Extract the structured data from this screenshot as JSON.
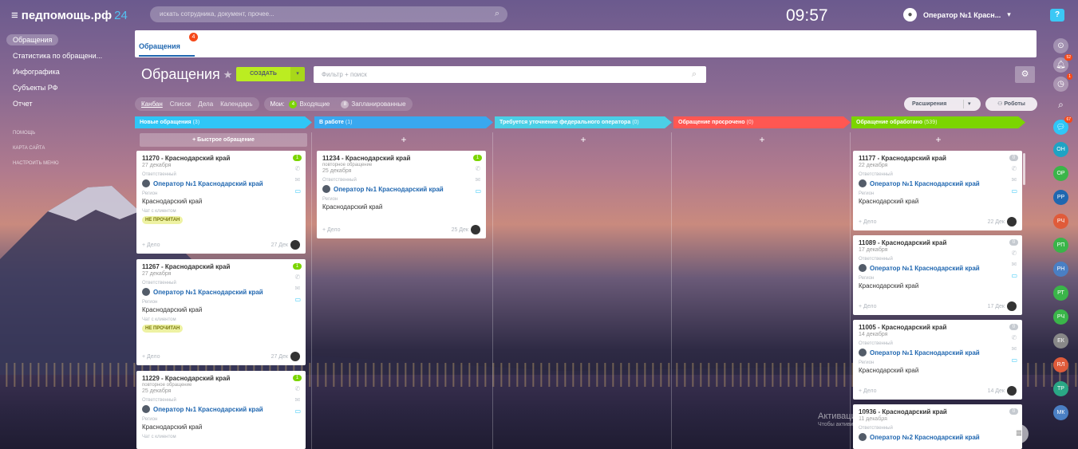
{
  "app": {
    "logo": "педпомощь.рф",
    "logo_num": "24",
    "search_placeholder": "искать сотрудника, документ, прочее...",
    "clock": "09:57",
    "user_name": "Оператор №1 Красн..."
  },
  "leftmenu": {
    "items": [
      "Обращения",
      "Статистика по обращени...",
      "Инфографика",
      "Субъекты РФ",
      "Отчет"
    ],
    "small": [
      "ПОМОЩЬ",
      "КАРТА САЙТА",
      "НАСТРОИТЬ МЕНЮ"
    ]
  },
  "tabs": {
    "active": "Обращения",
    "badge": "4"
  },
  "page": {
    "title": "Обращения",
    "create_label": "СОЗДАТЬ",
    "filter_placeholder": "Фильтр + поиск"
  },
  "viewbar": {
    "views": [
      "Канбан",
      "Список",
      "Дела",
      "Календарь"
    ],
    "mine": "Мои:",
    "incoming_count": "4",
    "incoming": "Входящие",
    "planned_count": "8",
    "planned": "Запланированные",
    "extensions": "Расширения",
    "robots": "Роботы"
  },
  "columns": [
    {
      "name": "Новые обращения",
      "count": "(3)",
      "color": "#2fc6f6"
    },
    {
      "name": "В работе",
      "count": "(1)",
      "color": "#39a8ef"
    },
    {
      "name": "Требуется уточнение федерального оператора",
      "count": "(0)",
      "color": "#4bcfe6"
    },
    {
      "name": "Обращение просрочено",
      "count": "(0)",
      "color": "#ff5752"
    },
    {
      "name": "Обращение обработано",
      "count": "(539)",
      "color": "#7bd500"
    }
  ],
  "quick_add": "+ Быстрое обращение",
  "labels": {
    "responsible": "Ответственный",
    "region": "Регион",
    "chat": "Чат с клиентом",
    "unread": "НЕ ПРОЧИТАН",
    "add_deal": "+ Дело",
    "repeat": "повторное обращение"
  },
  "cards": {
    "c11270": {
      "title": "11270 - Краснодарский край",
      "date": "27 декабря",
      "operator": "Оператор №1 Краснодарский край",
      "region": "Краснодарский край",
      "foot_date": "27 Дек",
      "badge": "1"
    },
    "c11267": {
      "title": "11267 - Краснодарский край",
      "date": "27 декабря",
      "operator": "Оператор №1 Краснодарский край",
      "region": "Краснодарский край",
      "foot_date": "27 Дек",
      "badge": "1"
    },
    "c11229": {
      "title": "11229 - Краснодарский край",
      "date": "25 декабря",
      "operator": "Оператор №1 Краснодарский край",
      "region": "Краснодарский край",
      "badge": "1"
    },
    "c11234": {
      "title": "11234 - Краснодарский край",
      "date": "25 декабря",
      "operator": "Оператор №1 Краснодарский край",
      "region": "Краснодарский край",
      "foot_date": "25 Дек",
      "badge": "1"
    },
    "c11177": {
      "title": "11177 - Краснодарский край",
      "date": "22 декабря",
      "operator": "Оператор №1 Краснодарский край",
      "region": "Краснодарский край",
      "foot_date": "22 Дек",
      "badge": "0"
    },
    "c11089": {
      "title": "11089 - Краснодарский край",
      "date": "17 декабря",
      "operator": "Оператор №1 Краснодарский край",
      "region": "Краснодарский край",
      "foot_date": "17 Дек",
      "badge": "0"
    },
    "c11005": {
      "title": "11005 - Краснодарский край",
      "date": "14 декабря",
      "operator": "Оператор №1 Краснодарский край",
      "region": "Краснодарский край",
      "foot_date": "14 Дек",
      "badge": "0"
    },
    "c10936": {
      "title": "10936 - Краснодарский край",
      "date": "11 декабря",
      "operator": "Оператор №2 Краснодарский край",
      "badge": "0"
    }
  },
  "rightbar": {
    "badge_notif": "52",
    "badge_time": "1",
    "badge_chat": "67",
    "avatars": [
      "ОН",
      "ОР",
      "РР",
      "РЧ",
      "РП",
      "РН",
      "РТ",
      "РЧ",
      "ЕК",
      "RЛ",
      "ТР",
      "МК"
    ],
    "avatar_colors": [
      "#1fa3c4",
      "#3ab549",
      "#2067b0",
      "#e05b3a",
      "#3ab549",
      "#4a7fc4",
      "#3ab549",
      "#3ab549",
      "#888888",
      "#e05b3a",
      "#2aa785",
      "#4a7fc4"
    ]
  },
  "watermark": {
    "line1": "Активация Windows",
    "line2": "Чтобы активировать Windows, перейдите в раздел \"Параметры\"."
  },
  "colors": {
    "accent": "#2067b0",
    "create": "#bbed21",
    "badge_red": "#f54819",
    "badge_green": "#7bd500"
  }
}
